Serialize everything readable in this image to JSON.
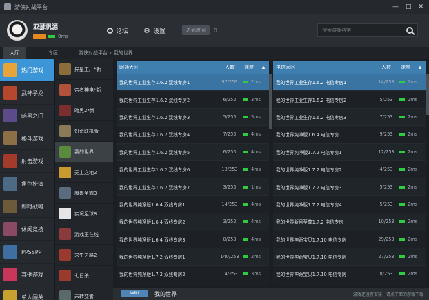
{
  "app": {
    "title": "游侠对战平台",
    "window_controls": [
      "—",
      "□",
      "✕"
    ]
  },
  "user": {
    "name": "亚瑟帆源",
    "ping": "0ms"
  },
  "header": {
    "forum_label": "论坛",
    "settings_label": "设置",
    "room_pill": "进到房间",
    "room_count": "0",
    "search_placeholder": "搜索游戏名字"
  },
  "tabs": [
    {
      "label": "大厅"
    },
    {
      "label": "专区"
    }
  ],
  "breadcrumb": {
    "root": "游侠对战平台",
    "sep": "›",
    "current": "我的世界"
  },
  "categories": [
    {
      "label": "热门游戏",
      "color": "#e6a43a"
    },
    {
      "label": "武神子龙",
      "color": "#b5472d"
    },
    {
      "label": "暗黑之门",
      "color": "#5b4b8a"
    },
    {
      "label": "格斗游戏",
      "color": "#8b6f47"
    },
    {
      "label": "射击游戏",
      "color": "#a33a2b"
    },
    {
      "label": "角色扮演",
      "color": "#4a6a86"
    },
    {
      "label": "即时战略",
      "color": "#6d5a3a"
    },
    {
      "label": "休闲竞技",
      "color": "#8a4a63"
    },
    {
      "label": "PPSSPP",
      "color": "#3e6fa0"
    },
    {
      "label": "其他游戏",
      "color": "#c8375a"
    },
    {
      "label": "单人闯关",
      "color": "#c7a12f"
    }
  ],
  "games": [
    {
      "label": "异星工厂*新",
      "color": "#8a6d3b"
    },
    {
      "label": "帝者神电*新",
      "color": "#b0533a"
    },
    {
      "label": "暗黑2*新",
      "color": "#7a2e2e"
    },
    {
      "label": "饥荒联机版",
      "color": "#8a7a5a"
    },
    {
      "label": "我的世界",
      "color": "#5b8a3a"
    },
    {
      "label": "无主之地2",
      "color": "#c99a2e"
    },
    {
      "label": "魔兽争霸3",
      "color": "#5a6d80"
    },
    {
      "label": "实况足球8",
      "color": "#e6e6e6"
    },
    {
      "label": "游戏王在线",
      "color": "#8a3a3a"
    },
    {
      "label": "求生之路2",
      "color": "#9a3a2e"
    },
    {
      "label": "七日杀",
      "color": "#9a3a2a"
    },
    {
      "label": "未转变者",
      "color": "#5a6a6a"
    }
  ],
  "left_panel": {
    "title": "网通大区",
    "count_label": "人数",
    "speed_label": "速度",
    "arrow": "▲",
    "rows": [
      {
        "name": "我的世界工业生存1.6.2 双线专房1",
        "count": "97/253",
        "ms": "2ms"
      },
      {
        "name": "我的世界工业生存1.6.2 双线专房2",
        "count": "6/253",
        "ms": "3ms"
      },
      {
        "name": "我的世界工业生存1.6.2 双线专房3",
        "count": "5/253",
        "ms": "5ms"
      },
      {
        "name": "我的世界工业生存1.6.2 双线专房4",
        "count": "7/253",
        "ms": "4ms"
      },
      {
        "name": "我的世界工业生存1.6.2 双线专房5",
        "count": "6/253",
        "ms": "4ms"
      },
      {
        "name": "我的世界工业生存1.6.2 双线专房6",
        "count": "13/253",
        "ms": "4ms"
      },
      {
        "name": "我的世界工业生存1.6.2 双线专房7",
        "count": "3/253",
        "ms": "1ms"
      },
      {
        "name": "我的世界纯净版1.6.4 双线专房1",
        "count": "14/253",
        "ms": "4ms"
      },
      {
        "name": "我的世界纯净版1.6.4 双线专房2",
        "count": "3/253",
        "ms": "4ms"
      },
      {
        "name": "我的世界纯净版1.6.4 双线专房3",
        "count": "0/253",
        "ms": "4ms"
      },
      {
        "name": "我的世界纯净版1.7.2 双线专房1",
        "count": "140/253",
        "ms": "2ms"
      },
      {
        "name": "我的世界纯净版1.7.2 双线专房2",
        "count": "14/253",
        "ms": "3ms"
      }
    ]
  },
  "right_panel": {
    "title": "电信大区",
    "count_label": "人数",
    "speed_label": "速度",
    "arrow": "▲",
    "rows": [
      {
        "name": "我的世界工业生存1.6.2 电信专房1",
        "count": "14/253",
        "ms": "2ms"
      },
      {
        "name": "我的世界工业生存1.6.2 电信专房2",
        "count": "5/253",
        "ms": "2ms"
      },
      {
        "name": "我的世界工业生存1.6.2 电信专房3",
        "count": "7/253",
        "ms": "2ms"
      },
      {
        "name": "我的世界纯净版1.6.4 电信专房",
        "count": "9/253",
        "ms": "2ms"
      },
      {
        "name": "我的世界纯净版1.7.2 电信专房1",
        "count": "12/253",
        "ms": "2ms"
      },
      {
        "name": "我的世界纯净版1.7.2 电信专房2",
        "count": "4/253",
        "ms": "2ms"
      },
      {
        "name": "我的世界纯净版1.7.2 电信专房3",
        "count": "5/253",
        "ms": "2ms"
      },
      {
        "name": "我的世界纯净版1.7.2 电信专房4",
        "count": "5/253",
        "ms": "2ms"
      },
      {
        "name": "我的世界新月至尊1.7.2 电信专房",
        "count": "10/253",
        "ms": "2ms"
      },
      {
        "name": "我的世界神奇宝贝1.7.10 电信专房",
        "count": "29/253",
        "ms": "2ms"
      },
      {
        "name": "我的世界神奇宝贝1.7.10 电信专房",
        "count": "27/253",
        "ms": "2ms"
      },
      {
        "name": "我的世界神奇宝贝1.7.10 电信专房",
        "count": "8/253",
        "ms": "2ms"
      }
    ]
  },
  "bottom": {
    "logo": "Wiki",
    "title": "我的世界",
    "note": "游戏还没有安装，请点下面的游戏下载"
  }
}
